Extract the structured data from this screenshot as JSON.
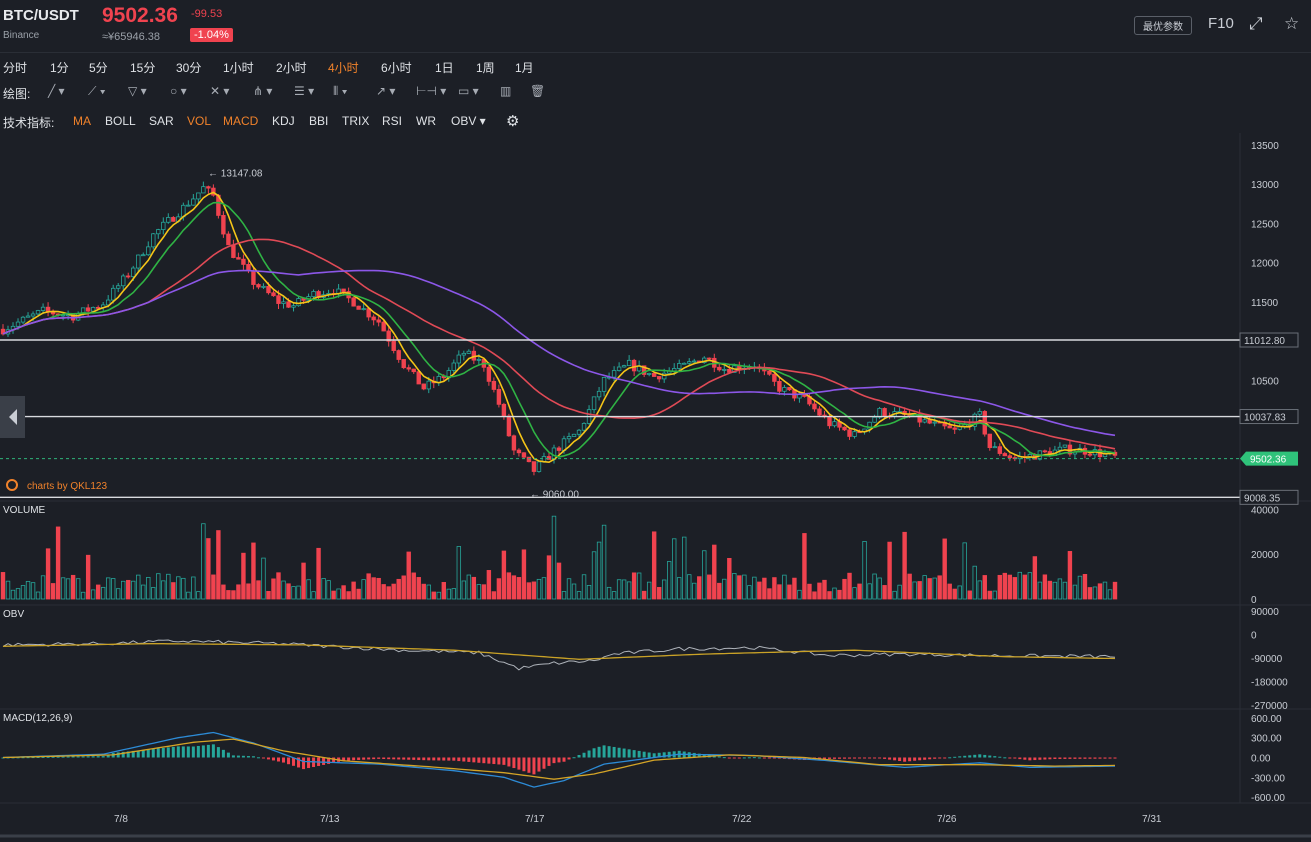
{
  "header": {
    "pair": "BTC/USDT",
    "exchange": "Binance",
    "price": "9502.36",
    "change": "-99.53",
    "cny": "≈¥65946.38",
    "pct": "-1.04%",
    "params_button": "最优参数",
    "f10_label": "F10",
    "fullscreen_icon": "⤢",
    "star_icon": "☆"
  },
  "timeframes": [
    {
      "label": "分时",
      "active": false
    },
    {
      "label": "1分",
      "active": false
    },
    {
      "label": "5分",
      "active": false
    },
    {
      "label": "15分",
      "active": false
    },
    {
      "label": "30分",
      "active": false
    },
    {
      "label": "1小时",
      "active": false
    },
    {
      "label": "2小时",
      "active": false
    },
    {
      "label": "4小时",
      "active": true
    },
    {
      "label": "6小时",
      "active": false
    },
    {
      "label": "1日",
      "active": false
    },
    {
      "label": "1周",
      "active": false
    },
    {
      "label": "1月",
      "active": false
    }
  ],
  "drawing": {
    "label": "绘图:",
    "tools": [
      {
        "icon": "line-icon",
        "glyph": "╱ ▾"
      },
      {
        "icon": "ray-icon",
        "glyph": "⟋ ▾"
      },
      {
        "icon": "channel-icon",
        "glyph": "▽ ▾"
      },
      {
        "icon": "circle-icon",
        "glyph": "○ ▾"
      },
      {
        "icon": "cross-icon",
        "glyph": "✕ ▾"
      },
      {
        "icon": "pitchfork-icon",
        "glyph": "⋔ ▾"
      },
      {
        "icon": "fib-icon",
        "glyph": "☰ ▾"
      },
      {
        "icon": "gann-icon",
        "glyph": "⦀ ▾"
      },
      {
        "icon": "arrow-icon",
        "glyph": "↗ ▾"
      },
      {
        "icon": "measure-icon",
        "glyph": "⊢⊣ ▾"
      },
      {
        "icon": "comment-icon",
        "glyph": "▭ ▾"
      },
      {
        "icon": "bars-icon",
        "glyph": "▥"
      },
      {
        "icon": "trash-icon",
        "glyph": "🗑"
      }
    ]
  },
  "indicators": {
    "label": "技术指标:",
    "items": [
      {
        "label": "MA",
        "active": true
      },
      {
        "label": "BOLL",
        "active": false
      },
      {
        "label": "SAR",
        "active": false
      },
      {
        "label": "VOL",
        "active": true
      },
      {
        "label": "MACD",
        "active": true
      },
      {
        "label": "KDJ",
        "active": false
      },
      {
        "label": "BBI",
        "active": false
      },
      {
        "label": "TRIX",
        "active": false
      },
      {
        "label": "RSI",
        "active": false
      },
      {
        "label": "WR",
        "active": false
      },
      {
        "label": "OBV ▾",
        "active": false
      }
    ],
    "settings_glyph": "⚙"
  },
  "colors": {
    "bg": "#1c1f26",
    "grid": "#2a2e36",
    "up": "#26a69a",
    "down": "#f0434f",
    "ma_yellow": "#f5c518",
    "ma_green": "#2fb344",
    "ma_red": "#e04a56",
    "ma_purple": "#8c57e8",
    "obv_gray": "#aeb3ba",
    "obv_gold": "#c9a227",
    "macd_dif": "#2d8bd6",
    "macd_dea": "#d4a427",
    "price_line": "#2fb37a",
    "label_bg": "#2fc27a",
    "hline": "#d8dade",
    "axis_text": "#c9cdd4"
  },
  "chart_data": {
    "type": "candlestick",
    "watermark": "charts by QKL123",
    "price_axis": {
      "ticks": [
        13500,
        13000,
        12500,
        12000,
        11500,
        11000,
        10500,
        10000,
        9500
      ],
      "range": [
        9000,
        13650
      ]
    },
    "x_labels": [
      "7/8",
      "7/13",
      "7/17",
      "7/22",
      "7/26",
      "7/31"
    ],
    "annotations": {
      "high_label": "13147.08",
      "high_value": 13147.08,
      "low_label": "9060.00",
      "low_value": 9060.0
    },
    "hlines": [
      {
        "value": 11012.8,
        "label": "11012.80"
      },
      {
        "value": 10037.83,
        "label": "10037.83"
      },
      {
        "value": 9008.35,
        "label": "9008.35"
      }
    ],
    "current_price": {
      "value": 9502.36,
      "label": "9502.36"
    },
    "price_keys": [
      [
        0,
        11150
      ],
      [
        8,
        11380
      ],
      [
        14,
        11320
      ],
      [
        20,
        11480
      ],
      [
        25,
        11850
      ],
      [
        30,
        12350
      ],
      [
        36,
        12700
      ],
      [
        40,
        12950
      ],
      [
        42,
        12850
      ],
      [
        45,
        12200
      ],
      [
        50,
        11750
      ],
      [
        55,
        11500
      ],
      [
        58,
        11450
      ],
      [
        62,
        11600
      ],
      [
        66,
        11650
      ],
      [
        70,
        11500
      ],
      [
        75,
        11250
      ],
      [
        80,
        10700
      ],
      [
        84,
        10400
      ],
      [
        88,
        10550
      ],
      [
        92,
        10850
      ],
      [
        96,
        10700
      ],
      [
        99,
        10200
      ],
      [
        102,
        9600
      ],
      [
        106,
        9350
      ],
      [
        110,
        9600
      ],
      [
        115,
        9850
      ],
      [
        120,
        10500
      ],
      [
        125,
        10700
      ],
      [
        130,
        10550
      ],
      [
        136,
        10680
      ],
      [
        140,
        10800
      ],
      [
        144,
        10650
      ],
      [
        150,
        10700
      ],
      [
        155,
        10400
      ],
      [
        160,
        10250
      ],
      [
        165,
        9950
      ],
      [
        170,
        9800
      ],
      [
        175,
        10100
      ],
      [
        180,
        10050
      ],
      [
        185,
        9950
      ],
      [
        190,
        9850
      ],
      [
        195,
        10050
      ],
      [
        197,
        9650
      ],
      [
        202,
        9500
      ],
      [
        207,
        9560
      ],
      [
        212,
        9620
      ],
      [
        217,
        9600
      ],
      [
        222,
        9520
      ]
    ],
    "volume_axis": {
      "ticks": [
        40000,
        20000,
        0
      ],
      "max": 42000
    },
    "obv_axis": {
      "ticks": [
        90000,
        0,
        -90000,
        -180000,
        -270000
      ],
      "range": [
        -270000,
        90000
      ]
    },
    "obv_keys": [
      [
        0,
        -40000
      ],
      [
        20,
        -35000
      ],
      [
        35,
        -25000
      ],
      [
        45,
        -30000
      ],
      [
        55,
        -35000
      ],
      [
        65,
        -45000
      ],
      [
        80,
        -60000
      ],
      [
        95,
        -70000
      ],
      [
        103,
        -130000
      ],
      [
        110,
        -110000
      ],
      [
        118,
        -100000
      ],
      [
        122,
        -75000
      ],
      [
        135,
        -55000
      ],
      [
        150,
        -50000
      ],
      [
        165,
        -80000
      ],
      [
        180,
        -75000
      ],
      [
        195,
        -80000
      ],
      [
        222,
        -85000
      ]
    ],
    "obv_ma_keys": [
      [
        0,
        -45000
      ],
      [
        30,
        -35000
      ],
      [
        60,
        -40000
      ],
      [
        90,
        -60000
      ],
      [
        115,
        -95000
      ],
      [
        140,
        -75000
      ],
      [
        170,
        -60000
      ],
      [
        200,
        -85000
      ],
      [
        222,
        -92000
      ]
    ],
    "macd_axis": {
      "ticks": [
        600,
        300,
        0,
        -300,
        -600
      ],
      "range": [
        -630,
        630
      ]
    },
    "dif_keys": [
      [
        0,
        0
      ],
      [
        20,
        50
      ],
      [
        35,
        300
      ],
      [
        42,
        380
      ],
      [
        50,
        220
      ],
      [
        60,
        -60
      ],
      [
        75,
        -100
      ],
      [
        90,
        -200
      ],
      [
        100,
        -300
      ],
      [
        106,
        -450
      ],
      [
        112,
        -350
      ],
      [
        120,
        -100
      ],
      [
        135,
        50
      ],
      [
        150,
        30
      ],
      [
        165,
        -50
      ],
      [
        180,
        -150
      ],
      [
        195,
        -80
      ],
      [
        205,
        -150
      ],
      [
        222,
        -130
      ]
    ],
    "dea_keys": [
      [
        0,
        0
      ],
      [
        22,
        40
      ],
      [
        38,
        230
      ],
      [
        46,
        280
      ],
      [
        56,
        100
      ],
      [
        68,
        -50
      ],
      [
        85,
        -140
      ],
      [
        100,
        -230
      ],
      [
        110,
        -330
      ],
      [
        118,
        -250
      ],
      [
        130,
        -40
      ],
      [
        145,
        40
      ],
      [
        160,
        0
      ],
      [
        175,
        -110
      ],
      [
        195,
        -110
      ],
      [
        210,
        -130
      ],
      [
        222,
        -120
      ]
    ],
    "series": [
      {
        "name": "MA"
      },
      {
        "name": "VOLUME"
      },
      {
        "name": "OBV"
      },
      {
        "name": "MACD(12,26,9)"
      }
    ]
  }
}
